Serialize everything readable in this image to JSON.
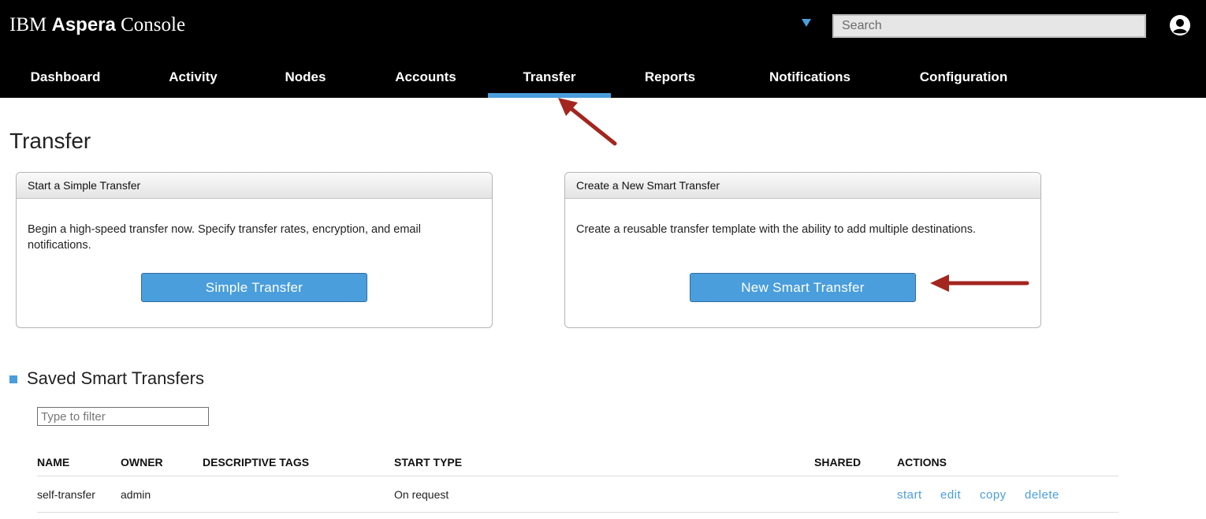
{
  "app": {
    "brand_prefix": "IBM",
    "brand_name": "Aspera",
    "brand_suffix": "Console"
  },
  "search": {
    "placeholder": "Search"
  },
  "nav": {
    "items": [
      "Dashboard",
      "Activity",
      "Nodes",
      "Accounts",
      "Transfer",
      "Reports",
      "Notifications",
      "Configuration"
    ],
    "active": "Transfer"
  },
  "page": {
    "title": "Transfer"
  },
  "simple_panel": {
    "header": "Start a Simple Transfer",
    "description": "Begin a high-speed transfer now. Specify transfer rates, encryption, and email notifications.",
    "button": "Simple Transfer"
  },
  "smart_panel": {
    "header": "Create a New Smart Transfer",
    "description": "Create a reusable transfer template with the ability to add multiple destinations.",
    "button": "New Smart Transfer"
  },
  "saved": {
    "title": "Saved Smart Transfers",
    "filter_placeholder": "Type to filter",
    "columns": [
      "NAME",
      "OWNER",
      "DESCRIPTIVE TAGS",
      "START TYPE",
      "SHARED",
      "ACTIONS"
    ],
    "rows": [
      {
        "name": "self-transfer",
        "owner": "admin",
        "tags": "",
        "start_type": "On request",
        "shared": "",
        "actions": [
          "start",
          "edit",
          "copy",
          "delete"
        ]
      }
    ]
  },
  "colors": {
    "accent": "#4a9edc",
    "annotation_arrow": "#a3261f",
    "topbar": "#000000"
  },
  "icons": {
    "scope_dropdown": "caret-down-icon",
    "user": "user-circle-icon"
  }
}
